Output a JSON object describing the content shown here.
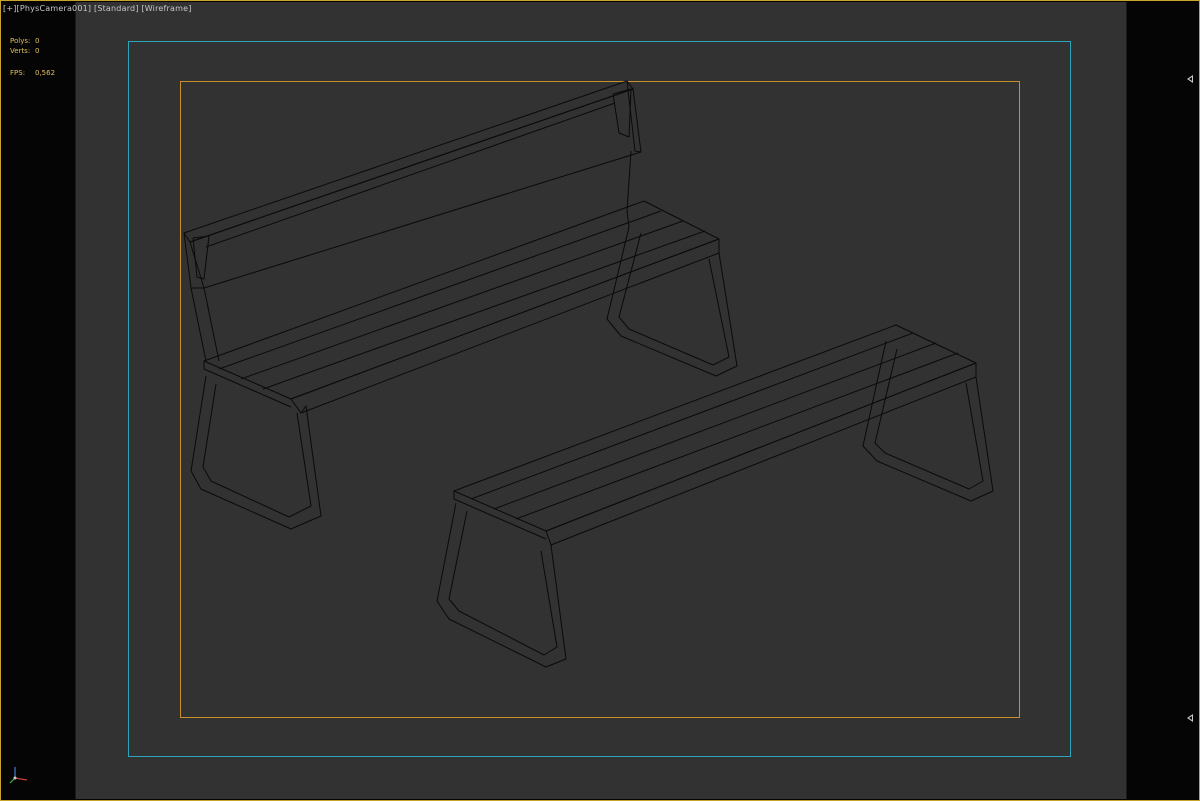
{
  "viewport": {
    "label_parts": [
      "[+]",
      "[PhysCamera001]",
      "[Standard]",
      "[Wireframe]"
    ]
  },
  "stats": {
    "polys_label": "Polys:",
    "polys_value": "0",
    "verts_label": "Verts:",
    "verts_value": "0",
    "fps_label": "FPS:",
    "fps_value": "0,562"
  },
  "colors": {
    "frame_border": "#c8a42a",
    "safe_frame": "#2aa6b8",
    "render_frame": "#c8902a",
    "viewport_bg": "#323232",
    "wire": "#0a0a0a",
    "stat_text": "#e0c060"
  },
  "icons": {
    "axis_gizmo": "xyz-axis-icon",
    "arrow_top": "triangle-left-icon",
    "arrow_bottom": "triangle-left-icon"
  }
}
